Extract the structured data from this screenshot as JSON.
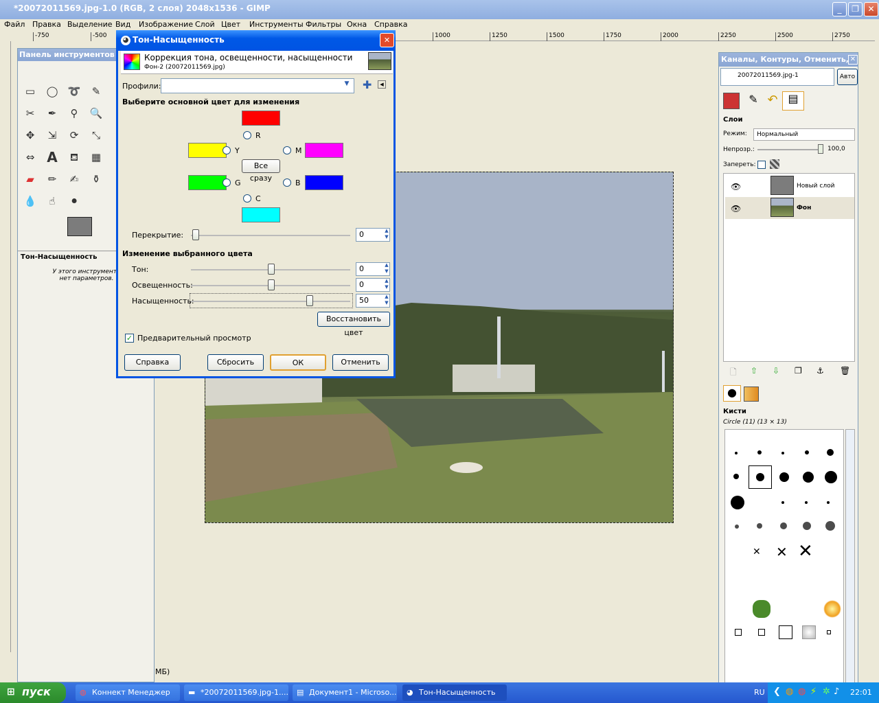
{
  "main_window": {
    "title": "*20072011569.jpg-1.0 (RGB, 2 слоя) 2048x1536 - GIMP",
    "menu": [
      "Файл",
      "Правка",
      "Выделение",
      "Вид",
      "Изображение",
      "Слой",
      "Цвет",
      "Инструменты",
      "Фильтры",
      "Окна",
      "Справка"
    ],
    "ruler_ticks": [
      "-750",
      "-500",
      "1000",
      "1250",
      "1500",
      "1750",
      "2000",
      "2250",
      "2500",
      "2750"
    ],
    "status": "МБ)"
  },
  "toolbox": {
    "title": "Панель инструментов",
    "tool_options_title": "Тон-Насыщенность",
    "tool_options_note": "У этого инструмента нет параметров.",
    "fg_color": "#7c7c7c",
    "bg_color": "#ffffff"
  },
  "dialog": {
    "title": "Тон-Насыщенность",
    "header_title": "Коррекция тона, освещенности, насыщенности",
    "header_sub": "Фон-2 (20072011569.jpg)",
    "profiles_label": "Профили:",
    "profiles_value": "",
    "section_primary": "Выберите основной цвет для изменения",
    "colors": {
      "R": {
        "label": "R",
        "color": "#ff0000"
      },
      "Y": {
        "label": "Y",
        "color": "#ffff00"
      },
      "M": {
        "label": "M",
        "color": "#ff00ff"
      },
      "G": {
        "label": "G",
        "color": "#00ff00"
      },
      "B": {
        "label": "B",
        "color": "#0000ff"
      },
      "C": {
        "label": "C",
        "color": "#00ffff"
      }
    },
    "all_button": "Все сразу",
    "overlap_label": "Перекрытие:",
    "overlap_value": "0",
    "section_adjust": "Изменение выбранного цвета",
    "hue_label": "Тон:",
    "hue_value": "0",
    "light_label": "Освещенность:",
    "light_value": "0",
    "sat_label": "Насыщенность:",
    "sat_value": "50",
    "reset_color_button": "Восстановить цвет",
    "preview_label": "Предварительный просмотр",
    "preview_checked": true,
    "help_button": "Справка",
    "reset_button": "Сбросить",
    "ok_button": "ОК",
    "cancel_button": "Отменить"
  },
  "dock": {
    "title": "Каналы, Контуры, Отменить, ...",
    "image_select": "20072011569.jpg-1",
    "auto_button": "Авто",
    "layers_title": "Слои",
    "mode_label": "Режим:",
    "mode_value": "Нормальный",
    "opacity_label": "Непрозр.:",
    "opacity_value": "100,0",
    "lock_label": "Запереть:",
    "layers": [
      {
        "name": "Новый слой"
      },
      {
        "name": "Фон"
      }
    ],
    "brushes_title": "Кисти",
    "brush_current": "Circle (11) (13 × 13)"
  },
  "taskbar": {
    "start": "пуск",
    "tasks": [
      "Коннект Менеджер",
      "*20072011569.jpg-1....",
      "Документ1 - Microso...",
      "Тон-Насыщенность"
    ],
    "lang": "RU",
    "clock": "22:01"
  }
}
